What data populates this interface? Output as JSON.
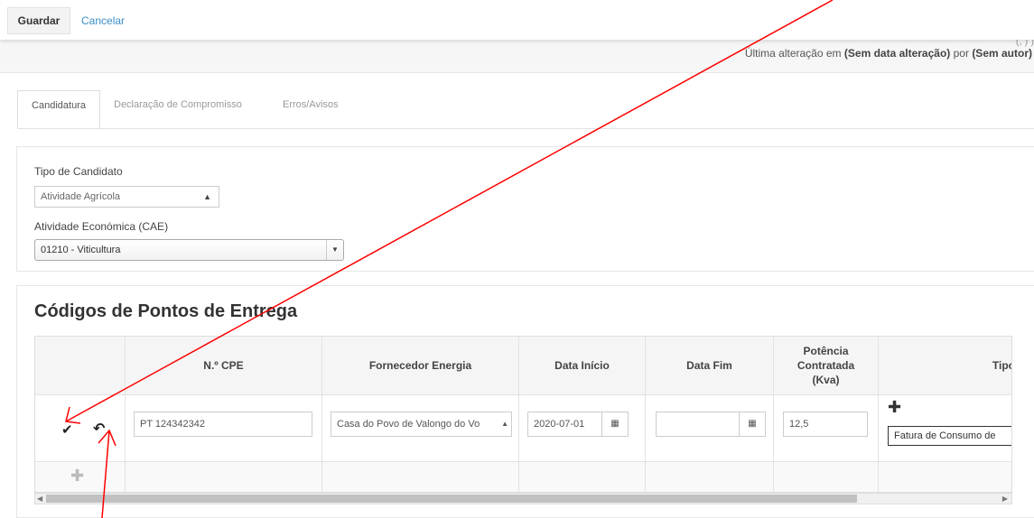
{
  "toolbar": {
    "save_label": "Guardar",
    "cancel_label": "Cancelar"
  },
  "infobar": {
    "faded_text": "(, ) )",
    "last_change_prefix": "Última alteração em",
    "last_change_date": "(Sem data alteração)",
    "last_change_by": "por",
    "last_change_author": "(Sem autor)"
  },
  "tabs": [
    {
      "label": "Candidatura",
      "active": true
    },
    {
      "label": "Declaração de Compromisso",
      "active": false
    },
    {
      "label": "Erros/Avisos",
      "active": false
    }
  ],
  "form": {
    "candidate_type_label": "Tipo de Candidato",
    "candidate_type_value": "Atividade Agrícola",
    "cae_label": "Atividade Económica (CAE)",
    "cae_value": "01210 - Viticultura"
  },
  "delivery_points": {
    "title": "Códigos de Pontos de Entrega",
    "columns": [
      "",
      "N.º CPE",
      "Fornecedor Energia",
      "Data Início",
      "Data Fim",
      "Potência Contratada (Kva)",
      "Tipo"
    ],
    "row": {
      "cpe": "PT 124342342",
      "supplier": "Casa do Povo de Valongo do Vo",
      "start_date": "2020-07-01",
      "end_date": "",
      "power": "12,5",
      "doc_type": "Fatura de Consumo de"
    }
  },
  "icons": {
    "confirm": "check-icon",
    "undo": "undo-icon",
    "add_doc": "plus-icon",
    "add_row": "plus-icon",
    "calendar": "calendar-icon"
  },
  "colors": {
    "link": "#3a8fc7",
    "annotation": "#ff0000"
  }
}
